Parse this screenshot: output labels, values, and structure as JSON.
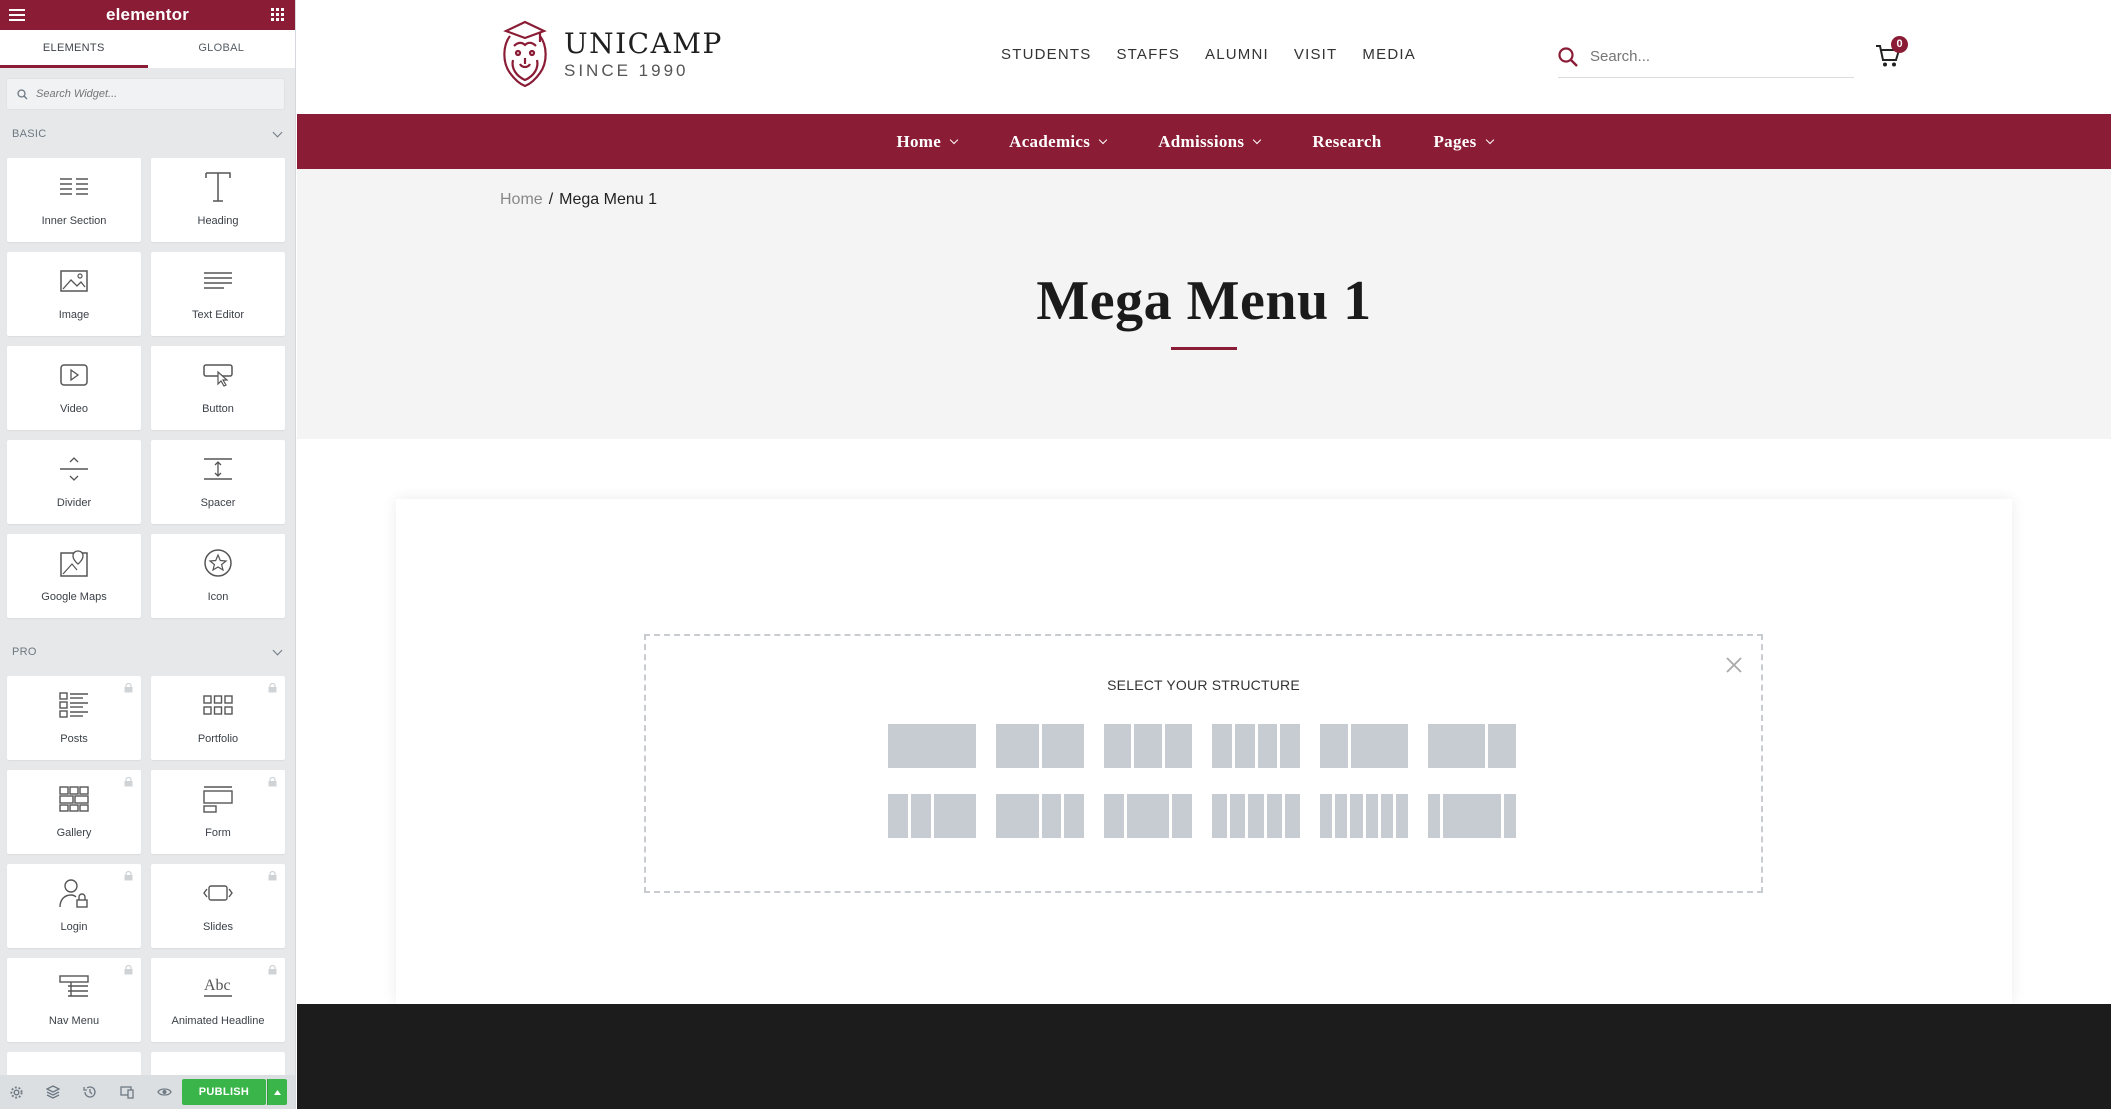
{
  "sidebar": {
    "logo": "elementor",
    "tabs": [
      "ELEMENTS",
      "GLOBAL"
    ],
    "search_placeholder": "Search Widget...",
    "basic_title": "BASIC",
    "pro_title": "PRO",
    "basic_widgets": [
      "Inner Section",
      "Heading",
      "Image",
      "Text Editor",
      "Video",
      "Button",
      "Divider",
      "Spacer",
      "Google Maps",
      "Icon"
    ],
    "pro_widgets": [
      "Posts",
      "Portfolio",
      "Gallery",
      "Form",
      "Login",
      "Slides",
      "Nav Menu",
      "Animated Headline"
    ],
    "publish_label": "PUBLISH"
  },
  "header": {
    "brand_name": "UNICAMP",
    "brand_since": "SINCE 1990",
    "top_links": [
      "STUDENTS",
      "STAFFS",
      "ALUMNI",
      "VISIT",
      "MEDIA"
    ],
    "search_placeholder": "Search...",
    "cart_count": "0"
  },
  "mainnav": [
    "Home",
    "Academics",
    "Admissions",
    "Research",
    "Pages"
  ],
  "breadcrumb": {
    "home": "Home",
    "sep": "/",
    "current": "Mega Menu 1"
  },
  "page_title": "Mega Menu 1",
  "structure_title": "SELECT YOUR STRUCTURE",
  "colors": {
    "brand": "#8a1c35",
    "publish": "#39b54a"
  }
}
